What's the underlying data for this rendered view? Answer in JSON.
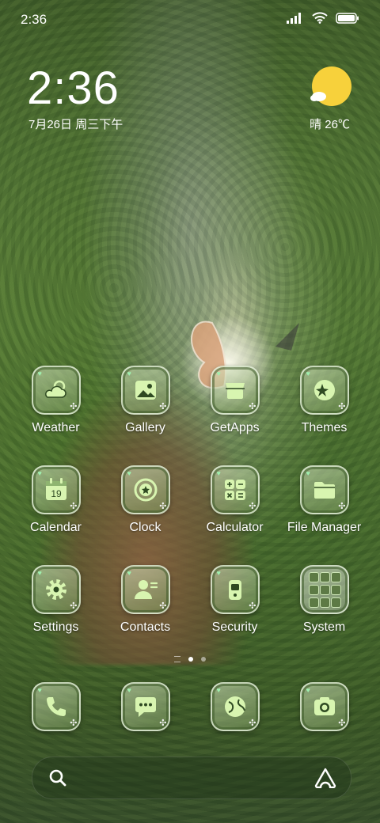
{
  "status_bar": {
    "time": "2:36"
  },
  "clock_widget": {
    "time": "2:36",
    "date": "7月26日 周三下午"
  },
  "weather_widget": {
    "text": "晴 26℃",
    "icon": "sun-cloud-icon",
    "sun_color": "#f7d13b"
  },
  "apps": [
    {
      "label": "Weather",
      "icon": "weather-icon"
    },
    {
      "label": "Gallery",
      "icon": "gallery-icon"
    },
    {
      "label": "GetApps",
      "icon": "getapps-icon"
    },
    {
      "label": "Themes",
      "icon": "themes-icon"
    },
    {
      "label": "Calendar",
      "icon": "calendar-icon",
      "day": "19"
    },
    {
      "label": "Clock",
      "icon": "clock-icon"
    },
    {
      "label": "Calculator",
      "icon": "calculator-icon"
    },
    {
      "label": "File Manager",
      "icon": "folder-icon"
    },
    {
      "label": "Settings",
      "icon": "gear-icon"
    },
    {
      "label": "Contacts",
      "icon": "contacts-icon"
    },
    {
      "label": "Security",
      "icon": "security-icon"
    },
    {
      "label": "System",
      "icon": "folder-grid-icon"
    }
  ],
  "dock": [
    {
      "name": "phone",
      "icon": "phone-icon"
    },
    {
      "name": "messages",
      "icon": "message-icon"
    },
    {
      "name": "browser",
      "icon": "browser-icon"
    },
    {
      "name": "camera",
      "icon": "camera-icon"
    }
  ],
  "pager": {
    "pages": 2,
    "current": 1
  },
  "search_bar": {
    "icon": "search-icon",
    "assistant_icon": "assistant-icon"
  },
  "colors": {
    "icon_fill": "#d8f5b0",
    "icon_dark": "#2f4a22",
    "tile_border": "#e6f0dc"
  }
}
